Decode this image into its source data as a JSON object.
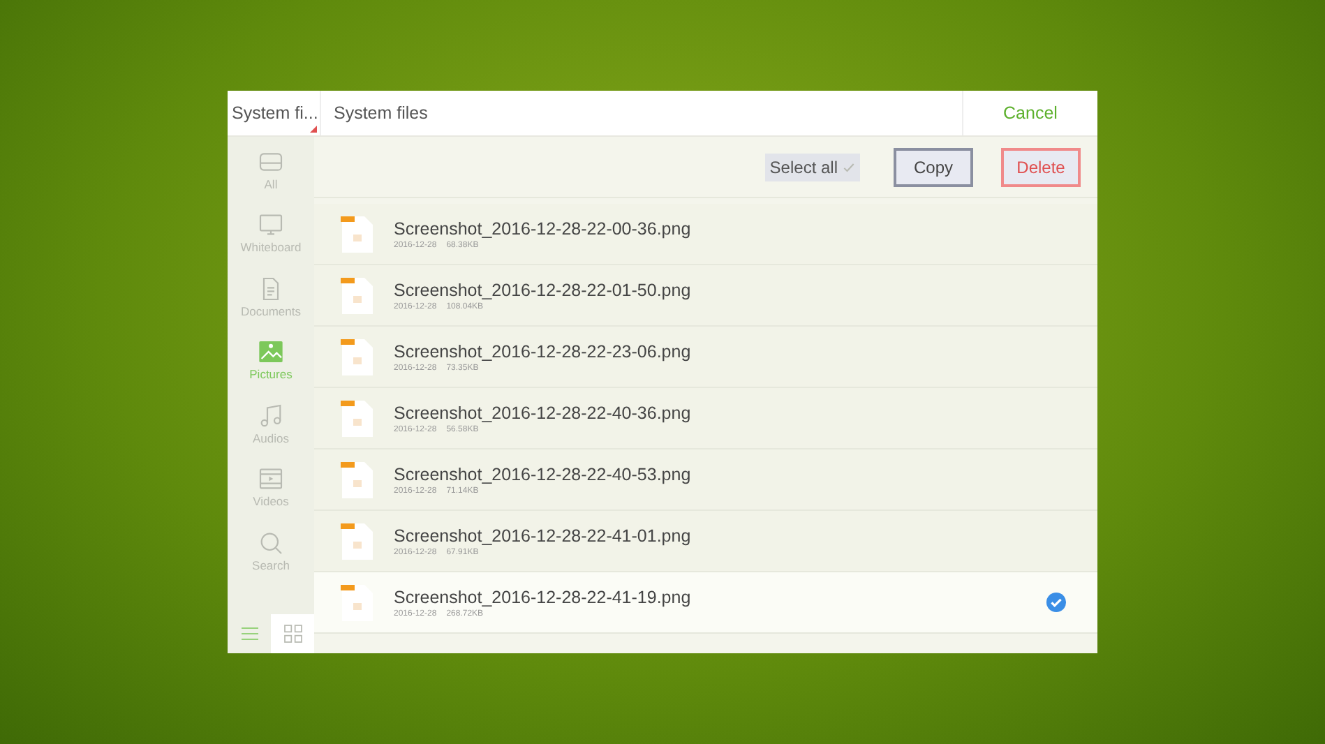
{
  "header": {
    "source": "System fi...",
    "breadcrumb": "System files",
    "cancel": "Cancel"
  },
  "sidebar": {
    "items": [
      {
        "kind": "all",
        "label": "All",
        "selected": false
      },
      {
        "kind": "whiteboard",
        "label": "Whiteboard",
        "selected": false
      },
      {
        "kind": "documents",
        "label": "Documents",
        "selected": false
      },
      {
        "kind": "pictures",
        "label": "Pictures",
        "selected": true
      },
      {
        "kind": "audios",
        "label": "Audios",
        "selected": false
      },
      {
        "kind": "videos",
        "label": "Videos",
        "selected": false
      },
      {
        "kind": "search",
        "label": "Search",
        "selected": false
      }
    ],
    "views": [
      {
        "kind": "list",
        "selected": true
      },
      {
        "kind": "grid",
        "selected": false
      }
    ]
  },
  "toolbar": {
    "select_all": "Select all",
    "buttons": [
      {
        "kind": "copy",
        "label": "Copy"
      },
      {
        "kind": "delete",
        "label": "Delete"
      }
    ]
  },
  "files": [
    {
      "name": "Screenshot_2016-12-28-22-00-36.png",
      "date": "2016-12-28",
      "size": "68.38KB",
      "selected": false
    },
    {
      "name": "Screenshot_2016-12-28-22-01-50.png",
      "date": "2016-12-28",
      "size": "108.04KB",
      "selected": false
    },
    {
      "name": "Screenshot_2016-12-28-22-23-06.png",
      "date": "2016-12-28",
      "size": "73.35KB",
      "selected": false
    },
    {
      "name": "Screenshot_2016-12-28-22-40-36.png",
      "date": "2016-12-28",
      "size": "56.58KB",
      "selected": false
    },
    {
      "name": "Screenshot_2016-12-28-22-40-53.png",
      "date": "2016-12-28",
      "size": "71.14KB",
      "selected": false
    },
    {
      "name": "Screenshot_2016-12-28-22-41-01.png",
      "date": "2016-12-28",
      "size": "67.91KB",
      "selected": false
    },
    {
      "name": "Screenshot_2016-12-28-22-41-19.png",
      "date": "2016-12-28",
      "size": "268.72KB",
      "selected": true
    }
  ]
}
